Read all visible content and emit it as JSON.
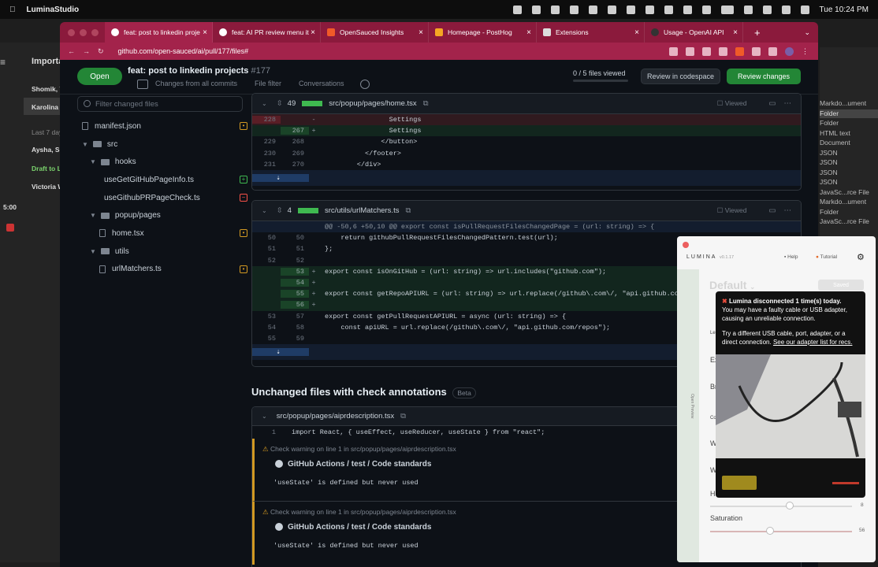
{
  "menubar": {
    "app": "LuminaStudio",
    "clock": "Tue 10:24 PM"
  },
  "bgapp": {
    "title": "Importa",
    "rows": [
      "Shomik, Y",
      "Karolina J",
      "Last 7 days",
      "Aysha, Sh",
      "Draft to L",
      "Victoria W"
    ],
    "time": "5:00",
    "right_items": [
      "Markdo...ument",
      "Folder",
      "Folder",
      "HTML text",
      "Document",
      "JSON",
      "JSON",
      "JSON",
      "JSON",
      "JavaSc...rce File",
      "Markdo...ument",
      "Folder",
      "JavaSc...rce File"
    ]
  },
  "browser": {
    "tabs": [
      {
        "label": "feat: post to linkedin proje",
        "active": true
      },
      {
        "label": "feat: AI PR review menu it",
        "active": false
      },
      {
        "label": "OpenSauced Insights",
        "active": false
      },
      {
        "label": "Homepage - PostHog",
        "active": false
      },
      {
        "label": "Extensions",
        "active": false
      },
      {
        "label": "Usage - OpenAI API",
        "active": false
      }
    ],
    "url": "github.com/open-sauced/ai/pull/177/files#"
  },
  "pr": {
    "state": "Open",
    "title": "feat: post to linkedin projects",
    "number": "#177",
    "changes_from": "Changes from all commits",
    "file_filter": "File filter",
    "conversations": "Conversations",
    "viewed": "0 / 5 files viewed",
    "codespace": "Review in codespace",
    "review": "Review changes"
  },
  "filetree": {
    "search_placeholder": "Filter changed files",
    "items": [
      {
        "name": "manifest.json",
        "type": "file",
        "depth": 0,
        "status": "modified"
      },
      {
        "name": "src",
        "type": "folder",
        "depth": 0
      },
      {
        "name": "hooks",
        "type": "folder",
        "depth": 1
      },
      {
        "name": "useGetGitHubPageInfo.ts",
        "type": "file",
        "depth": 2,
        "status": "added"
      },
      {
        "name": "useGithubPRPageCheck.ts",
        "type": "file",
        "depth": 2,
        "status": "removed"
      },
      {
        "name": "popup/pages",
        "type": "folder",
        "depth": 1
      },
      {
        "name": "home.tsx",
        "type": "file",
        "depth": 2,
        "status": "modified"
      },
      {
        "name": "utils",
        "type": "folder",
        "depth": 1
      },
      {
        "name": "urlMatchers.ts",
        "type": "file",
        "depth": 2,
        "status": "modified"
      }
    ]
  },
  "diff1": {
    "count": "49",
    "path": "src/popup/pages/home.tsx",
    "viewed": "Viewed",
    "rows": [
      {
        "t": "del",
        "a": "228",
        "b": "",
        "s": "-",
        "c": "                Settings"
      },
      {
        "t": "add",
        "a": "",
        "b": "267",
        "s": "+",
        "c": "                Settings"
      },
      {
        "t": "ctx",
        "a": "229",
        "b": "268",
        "s": "",
        "c": "              </button>"
      },
      {
        "t": "ctx",
        "a": "230",
        "b": "269",
        "s": "",
        "c": "          </footer>"
      },
      {
        "t": "ctx",
        "a": "231",
        "b": "270",
        "s": "",
        "c": "        </div>"
      }
    ]
  },
  "diff2": {
    "count": "4",
    "path": "src/utils/urlMatchers.ts",
    "viewed": "Viewed",
    "rows": [
      {
        "t": "hunk",
        "a": "",
        "b": "",
        "s": "",
        "c": "@@ -50,6 +50,10 @@ export const isPullRequestFilesChangedPage = (url: string) => {"
      },
      {
        "t": "ctx",
        "a": "50",
        "b": "50",
        "s": "",
        "c": "    return githubPullRequestFilesChangedPattern.test(url);"
      },
      {
        "t": "ctx",
        "a": "51",
        "b": "51",
        "s": "",
        "c": "};"
      },
      {
        "t": "ctx",
        "a": "52",
        "b": "52",
        "s": "",
        "c": ""
      },
      {
        "t": "add",
        "a": "",
        "b": "53",
        "s": "+",
        "c": "export const isOnGitHub = (url: string) => url.includes(\"github.com\");"
      },
      {
        "t": "add",
        "a": "",
        "b": "54",
        "s": "+",
        "c": ""
      },
      {
        "t": "add",
        "a": "",
        "b": "55",
        "s": "+",
        "c": "export const getRepoAPIURL = (url: string) => url.replace(/github\\.com\\/, \"api.github.com/"
      },
      {
        "t": "add",
        "a": "",
        "b": "56",
        "s": "+",
        "c": ""
      },
      {
        "t": "ctx",
        "a": "53",
        "b": "57",
        "s": "",
        "c": "export const getPullRequestAPIURL = async (url: string) => {"
      },
      {
        "t": "ctx",
        "a": "54",
        "b": "58",
        "s": "",
        "c": "    const apiURL = url.replace(/github\\.com\\/, \"api.github.com/repos\");"
      },
      {
        "t": "ctx",
        "a": "55",
        "b": "59",
        "s": "",
        "c": ""
      }
    ]
  },
  "unchanged": {
    "title": "Unchanged files with check annotations",
    "beta": "Beta",
    "file": "src/popup/pages/aiprdescription.tsx",
    "line": "1",
    "code": "import React, { useEffect, useReducer, useState } from \"react\";",
    "warnings": [
      {
        "head": "Check warning on line 1 in src/popup/pages/aiprdescription.tsx",
        "source": "GitHub Actions / test / Code standards",
        "msg": "'useState' is defined but never used"
      },
      {
        "head": "Check warning on line 1 in src/popup/pages/aiprdescription.tsx",
        "source": "GitHub Actions / test / Code standards",
        "msg": "'useState' is defined but never used"
      }
    ]
  },
  "lumina": {
    "brand": "LUMINA",
    "version": "v0.1.17",
    "help": "Help",
    "tutorial": "Tutorial",
    "preset": "Default",
    "saved": "Saved",
    "side": "Open Preview",
    "popup_title": "Lumina disconnected 1 time(s) today.",
    "popup_body": "You may have a faulty cable or USB adapter, causing an unreliable connection.",
    "popup_try": "Try a different USB cable, port, adapter, or a direct connection.",
    "popup_link": "See our adapter list for recs.",
    "hue_value": "8",
    "saturation_label": "Saturation",
    "saturation_value": "56",
    "labels": [
      "Le",
      "Ex",
      "Br",
      "Co",
      "W",
      "W",
      "Hu"
    ]
  }
}
